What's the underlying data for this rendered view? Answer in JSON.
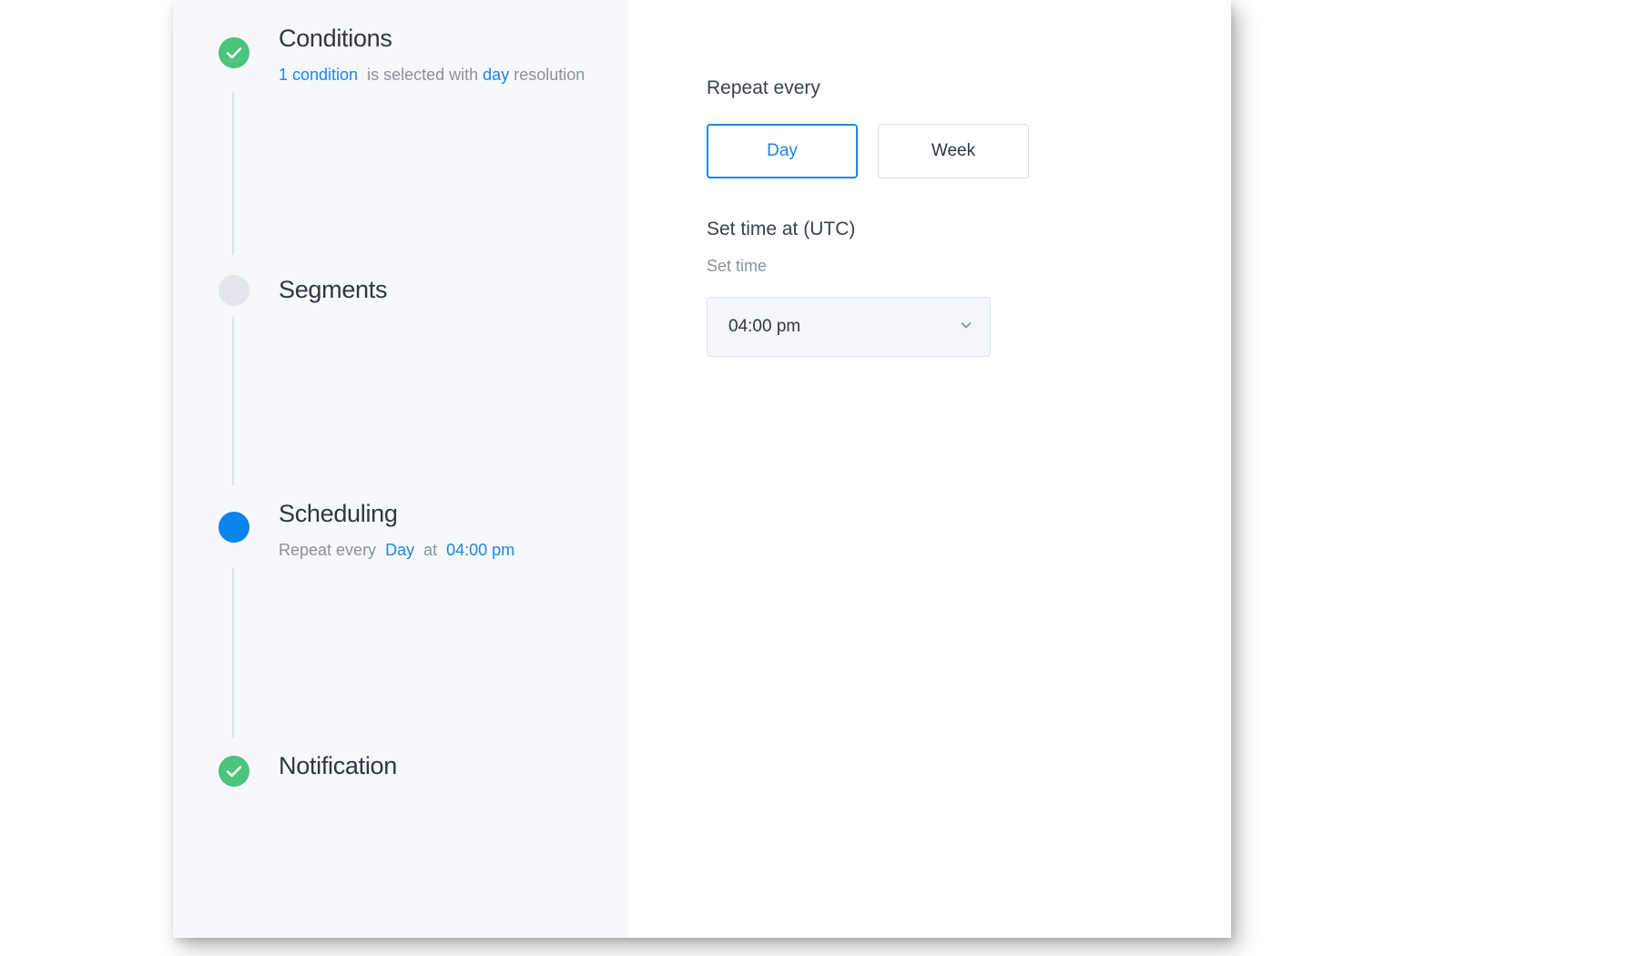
{
  "stepper": {
    "steps": [
      {
        "title": "Conditions",
        "status": "done",
        "subtitle": {
          "link": "1 condition",
          "text1": "is selected with",
          "highlight": "day",
          "text2": "resolution"
        }
      },
      {
        "title": "Segments",
        "status": "pending"
      },
      {
        "title": "Scheduling",
        "status": "active",
        "subtitle": {
          "text1": "Repeat every",
          "highlight1": "Day",
          "text2": "at",
          "highlight2": "04:00 pm"
        }
      },
      {
        "title": "Notification",
        "status": "done"
      }
    ]
  },
  "scheduling": {
    "repeat_label": "Repeat every",
    "options": [
      "Day",
      "Week"
    ],
    "selected": "Day",
    "time_label": "Set time at (UTC)",
    "time_sublabel": "Set time",
    "time_value": "04:00 pm"
  },
  "colors": {
    "accent": "#1a86e6",
    "done": "#4cc47b",
    "pending": "#e1e6ec",
    "active": "#0a84e8"
  }
}
